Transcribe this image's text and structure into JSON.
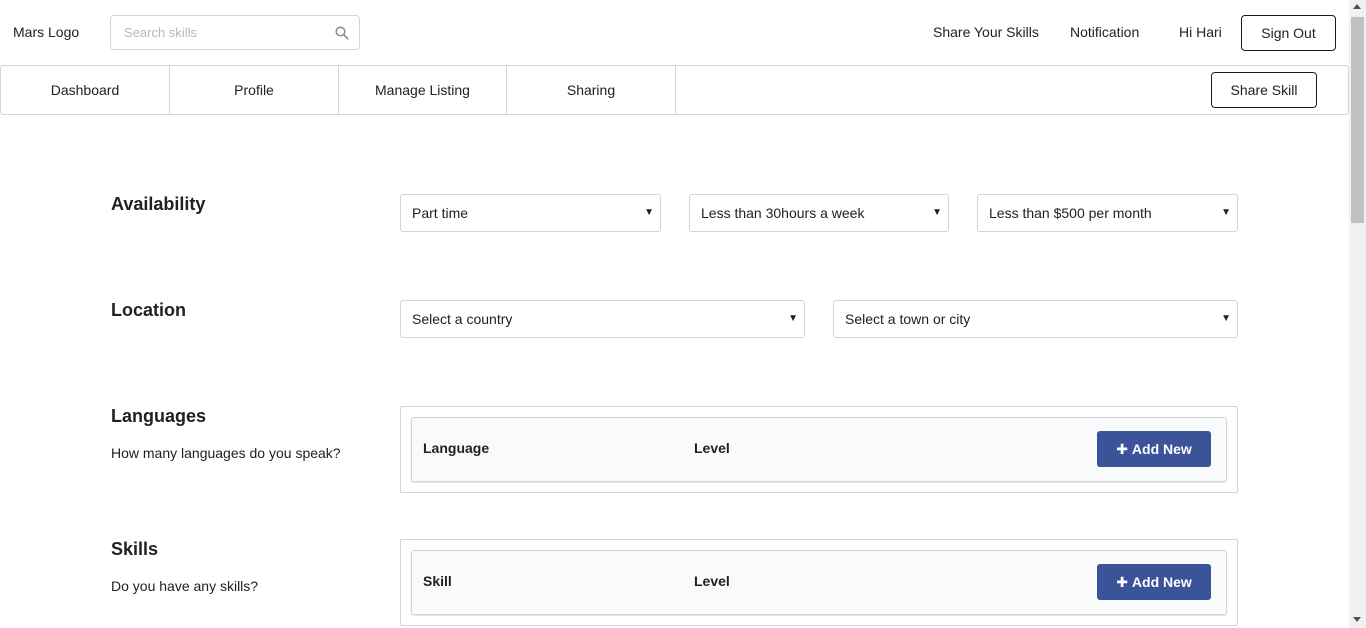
{
  "header": {
    "logo": "Mars Logo",
    "search_placeholder": "Search skills",
    "share_your_skills": "Share Your Skills",
    "notification": "Notification",
    "greeting": "Hi Hari",
    "sign_out": "Sign Out"
  },
  "tabs": [
    {
      "label": "Dashboard"
    },
    {
      "label": "Profile"
    },
    {
      "label": "Manage Listing"
    },
    {
      "label": "Sharing"
    }
  ],
  "share_skill_button": "Share Skill",
  "availability": {
    "title": "Availability",
    "type": "Part time",
    "hours": "Less than 30hours a week",
    "earn_target": "Less than $500 per month"
  },
  "location": {
    "title": "Location",
    "country": "Select a country",
    "city": "Select a town or city"
  },
  "languages": {
    "title": "Languages",
    "description": "How many languages do you speak?",
    "col1": "Language",
    "col2": "Level",
    "add_label": "Add New"
  },
  "skills": {
    "title": "Skills",
    "description": "Do you have any skills?",
    "col1": "Skill",
    "col2": "Level",
    "add_label": "Add New"
  },
  "colors": {
    "primary_button": "#3b5499",
    "border": "#d4d4d5",
    "table_header_bg": "#f9fafb"
  },
  "icons": {
    "search": "search-icon",
    "caret": "caret-down-icon",
    "plus": "plus-icon"
  }
}
